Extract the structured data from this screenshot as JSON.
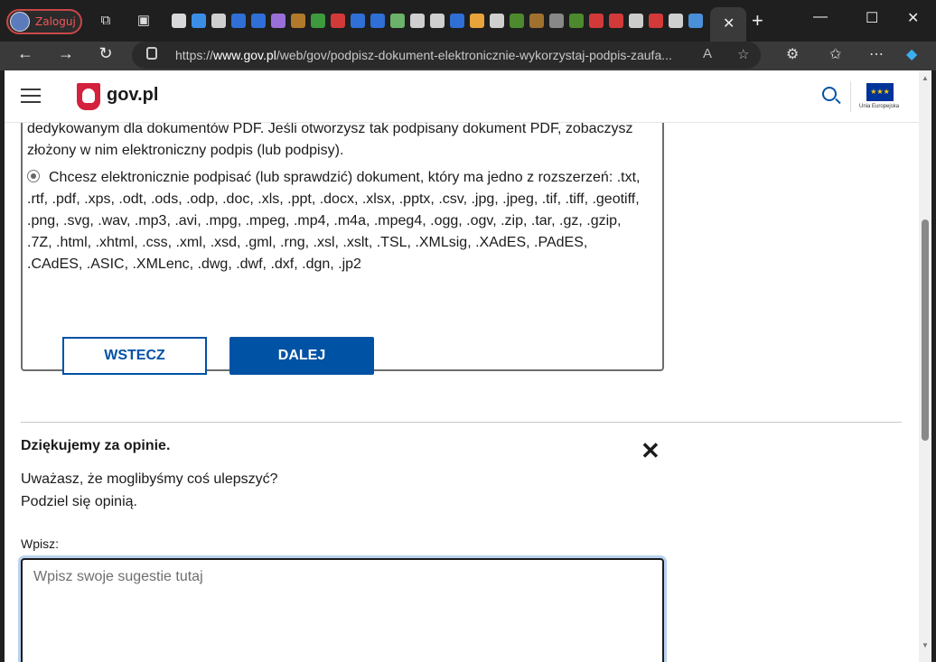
{
  "browser": {
    "profile_label": "Zaloguj",
    "url_prefix": "https://",
    "url_domain": "www.gov.pl",
    "url_path": "/web/gov/podpisz-dokument-elektronicznie-wykorzystaj-podpis-zaufa...",
    "active_tab_close": "✕",
    "new_tab": "+",
    "tab_favicon_colors": [
      "#d9d9d9",
      "#3a8ee6",
      "#cfcfcf",
      "#2f6fd6",
      "#2f6fd6",
      "#9a6fd8",
      "#b07a2a",
      "#3d9a3d",
      "#d23a3a",
      "#2f6fd6",
      "#2f6fd6",
      "#6bb36b",
      "#cfcfcf",
      "#cfcfcf",
      "#2f6fd6",
      "#e8a33b",
      "#cfcfcf",
      "#4c8a2d",
      "#a0702e",
      "#888888",
      "#4c8a2d",
      "#d23a3a",
      "#d23a3a",
      "#cccccc",
      "#d23a3a",
      "#cfcfcf",
      "#4a90d9"
    ]
  },
  "site": {
    "brand": "gov.pl",
    "eu_label": "Unia Europejska",
    "eu_stars": "★★★"
  },
  "card": {
    "top_text": "dedykowanym dla dokumentów PDF. Jeśli otworzysz tak podpisany dokument PDF, zobaczysz złożony w nim elektroniczny podpis (lub podpisy).",
    "radio_text": "Chcesz elektronicznie podpisać (lub sprawdzić) dokument, który ma jedno z rozszerzeń: .txt, .rtf, .pdf, .xps, .odt, .ods, .odp, .doc, .xls, .ppt, .docx, .xlsx, .pptx, .csv, .jpg, .jpeg, .tif, .tiff, .geotiff, .png, .svg, .wav, .mp3, .avi, .mpg, .mpeg, .mp4, .m4a, .mpeg4, .ogg, .ogv, .zip, .tar, .gz, .gzip, .7Z, .html, .xhtml, .css, .xml, .xsd, .gml, .rng, .xsl, .xslt, .TSL, .XMLsig, .XAdES, .PAdES, .CAdES, .ASIC, .XMLenc, .dwg, .dwf, .dxf, .dgn, .jp2",
    "back_label": "WSTECZ",
    "next_label": "DALEJ"
  },
  "feedback": {
    "title": "Dziękujemy za opinie.",
    "question_line1": "Uważasz, że moglibyśmy coś ulepszyć?",
    "question_line2": "Podziel się opinią.",
    "input_label": "Wpisz:",
    "placeholder": "Wpisz swoje sugestie tutaj",
    "close": "✕"
  }
}
